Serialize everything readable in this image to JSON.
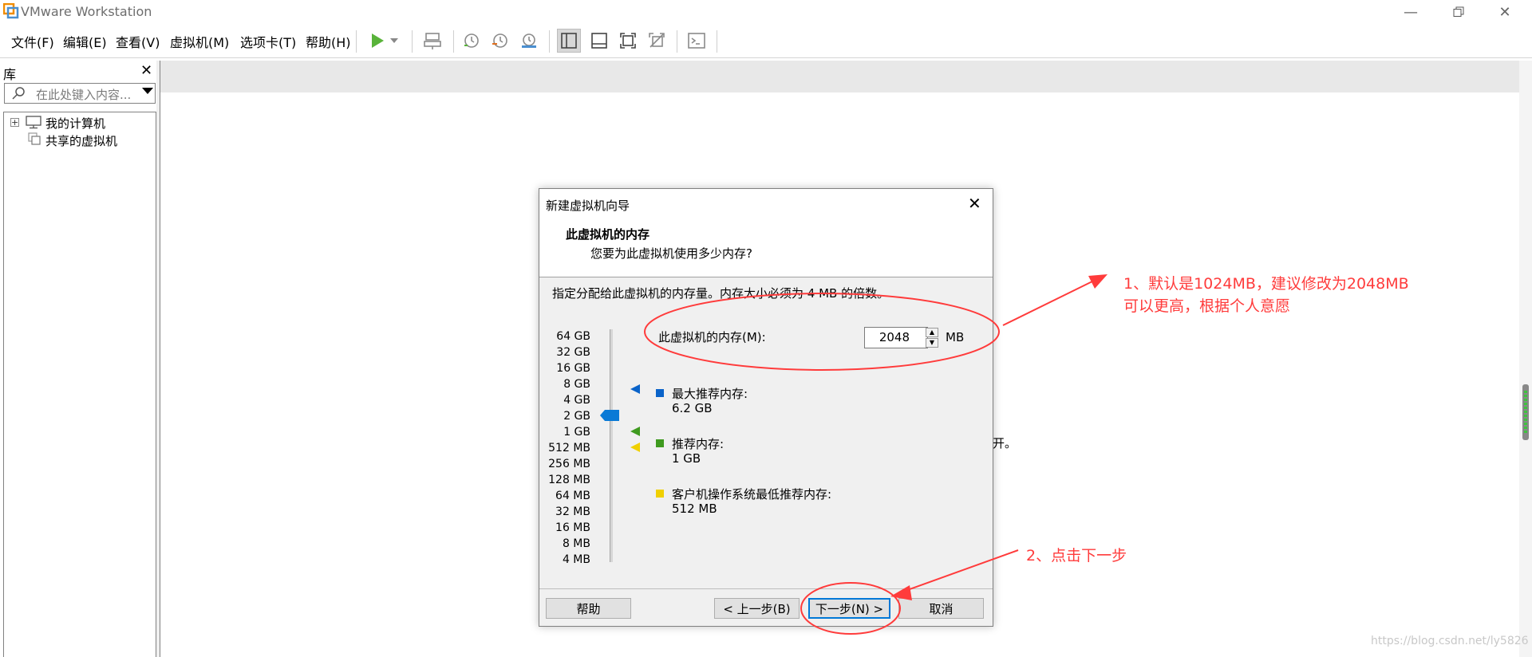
{
  "window": {
    "title": "VMware Workstation"
  },
  "menu": [
    {
      "label": "文件(F)"
    },
    {
      "label": "编辑(E)"
    },
    {
      "label": "查看(V)"
    },
    {
      "label": "虚拟机(M)"
    },
    {
      "label": "选项卡(T)"
    },
    {
      "label": "帮助(H)"
    }
  ],
  "library": {
    "title": "库",
    "search_placeholder": "在此处键入内容...",
    "tree": [
      {
        "label": "我的计算机"
      },
      {
        "label": "共享的虚拟机"
      }
    ]
  },
  "main": {
    "partial_text": "开。"
  },
  "dialog": {
    "title": "新建虚拟机向导",
    "heading": "此虚拟机的内存",
    "subheading": "您要为此虚拟机使用多少内存?",
    "instruction": "指定分配给此虚拟机的内存量。内存大小必须为 4 MB 的倍数。",
    "memory_label": "此虚拟机的内存(M):",
    "memory_value": "2048",
    "memory_unit": "MB",
    "scale_labels": [
      "64 GB",
      "32 GB",
      "16 GB",
      "8 GB",
      "4 GB",
      "2 GB",
      "1 GB",
      "512 MB",
      "256 MB",
      "128 MB",
      "64 MB",
      "32 MB",
      "16 MB",
      "8 MB",
      "4 MB"
    ],
    "legend": [
      {
        "title": "最大推荐内存:",
        "value": "6.2 GB",
        "color": "#0a63c9"
      },
      {
        "title": "推荐内存:",
        "value": "1 GB",
        "color": "#3f9a1f"
      },
      {
        "title": "客户机操作系统最低推荐内存:",
        "value": "512 MB",
        "color": "#f0d000"
      }
    ],
    "buttons": {
      "help": "帮助",
      "back": "< 上一步(B)",
      "next": "下一步(N) >",
      "cancel": "取消"
    }
  },
  "annotations": {
    "note1_line1": "1、默认是1024MB，建议修改为2048MB",
    "note1_line2": "可以更高，根据个人意愿",
    "note2": "2、点击下一步",
    "color": "#ff3b3b"
  },
  "watermark": "https://blog.csdn.net/ly5826"
}
